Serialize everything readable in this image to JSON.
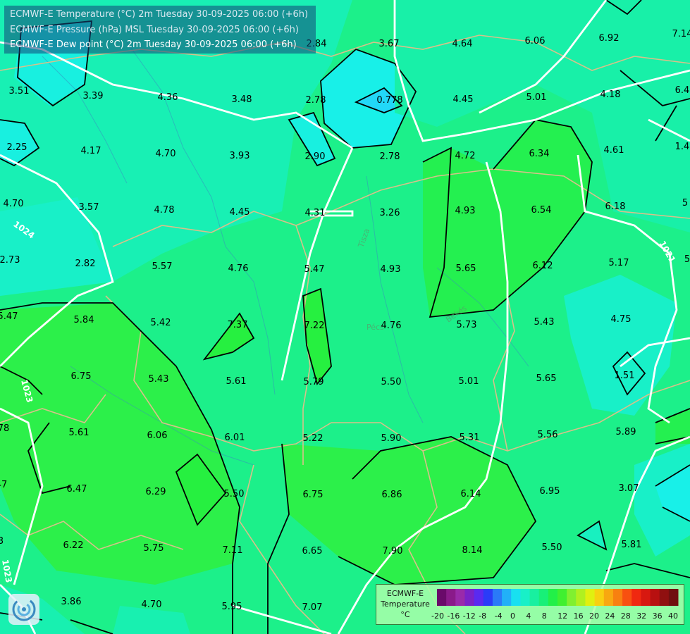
{
  "titles": [
    "ECMWF-E Temperature (°C) 2m Tuesday 30-09-2025 06:00 (+6h)",
    "ECMWF-E Pressure (hPa) MSL Tuesday 30-09-2025 06:00 (+6h)",
    "ECMWF-E Dew point (°C) 2m Tuesday 30-09-2025 06:00 (+6h)"
  ],
  "legend": {
    "line1": "ECMWF-E",
    "line2": "Temperature",
    "line3": "°C",
    "ticks": [
      "-20",
      "-16",
      "-12",
      "-8",
      "-4",
      "0",
      "4",
      "8",
      "12",
      "16",
      "20",
      "24",
      "28",
      "32",
      "36",
      "40"
    ],
    "colors": [
      "#6a0a6a",
      "#8a1a8a",
      "#9a2aaa",
      "#7a22c8",
      "#5a2af0",
      "#2a3cf8",
      "#2a7af8",
      "#22b0f8",
      "#18e0f0",
      "#18f0c8",
      "#18f0a0",
      "#18f078",
      "#22f048",
      "#40f030",
      "#80f030",
      "#b0f020",
      "#e0f010",
      "#f8d010",
      "#f8a810",
      "#f88010",
      "#f85010",
      "#f02810",
      "#d81810",
      "#b81010",
      "#901010",
      "#701010"
    ]
  },
  "isobars": [
    "1024",
    "1021",
    "1023"
  ],
  "city_labels": [
    "Pécs",
    "Tisza",
    "Békés"
  ],
  "values": [
    {
      "v": "3.67"
    },
    {
      "v": "4.64"
    },
    {
      "v": "6.06"
    },
    {
      "v": "6.92"
    },
    {
      "v": "7.14"
    },
    {
      "v": "2.84"
    },
    {
      "v": "3.51"
    },
    {
      "v": "3.39"
    },
    {
      "v": "4.36"
    },
    {
      "v": "3.48"
    },
    {
      "v": "2.78"
    },
    {
      "v": "0.778"
    },
    {
      "v": "4.45"
    },
    {
      "v": "5.01"
    },
    {
      "v": "4.18"
    },
    {
      "v": "6.4"
    },
    {
      "v": "2.25"
    },
    {
      "v": "4.17"
    },
    {
      "v": "4.70"
    },
    {
      "v": "3.93"
    },
    {
      "v": "2.90"
    },
    {
      "v": "2.78"
    },
    {
      "v": "4.72"
    },
    {
      "v": "6.34"
    },
    {
      "v": "4.61"
    },
    {
      "v": "1.4"
    },
    {
      "v": "4.70"
    },
    {
      "v": "3.57"
    },
    {
      "v": "4.78"
    },
    {
      "v": "4.45"
    },
    {
      "v": "4.31"
    },
    {
      "v": "3.26"
    },
    {
      "v": "4.93"
    },
    {
      "v": "6.54"
    },
    {
      "v": "6.18"
    },
    {
      "v": "5"
    },
    {
      "v": "2.73"
    },
    {
      "v": "2.82"
    },
    {
      "v": "5.57"
    },
    {
      "v": "4.76"
    },
    {
      "v": "5.47"
    },
    {
      "v": "4.93"
    },
    {
      "v": "5.65"
    },
    {
      "v": "6.12"
    },
    {
      "v": "5.17"
    },
    {
      "v": "5"
    },
    {
      "v": "5.47"
    },
    {
      "v": "5.84"
    },
    {
      "v": "5.42"
    },
    {
      "v": "7.37"
    },
    {
      "v": "7.22"
    },
    {
      "v": "4.76"
    },
    {
      "v": "5.73"
    },
    {
      "v": "5.43"
    },
    {
      "v": "4.75"
    },
    {
      "v": "6.75"
    },
    {
      "v": "5.43"
    },
    {
      "v": "5.61"
    },
    {
      "v": "5.79"
    },
    {
      "v": "5.50"
    },
    {
      "v": "5.01"
    },
    {
      "v": "5.65"
    },
    {
      "v": "1.51"
    },
    {
      "v": "78"
    },
    {
      "v": "5.61"
    },
    {
      "v": "6.06"
    },
    {
      "v": "6.01"
    },
    {
      "v": "5.22"
    },
    {
      "v": "5.90"
    },
    {
      "v": "5.31"
    },
    {
      "v": "5.56"
    },
    {
      "v": "5.89"
    },
    {
      "v": "47"
    },
    {
      "v": "6.47"
    },
    {
      "v": "6.29"
    },
    {
      "v": "5.50"
    },
    {
      "v": "6.75"
    },
    {
      "v": "6.86"
    },
    {
      "v": "6.14"
    },
    {
      "v": "6.95"
    },
    {
      "v": "3.07"
    },
    {
      "v": "3"
    },
    {
      "v": "6.22"
    },
    {
      "v": "5.75"
    },
    {
      "v": "7.11"
    },
    {
      "v": "6.65"
    },
    {
      "v": "7.90"
    },
    {
      "v": "8.14"
    },
    {
      "v": "5.50"
    },
    {
      "v": "5.81"
    },
    {
      "v": "3.86"
    },
    {
      "v": "4.70"
    },
    {
      "v": "5.95"
    },
    {
      "v": "7.07"
    }
  ]
}
